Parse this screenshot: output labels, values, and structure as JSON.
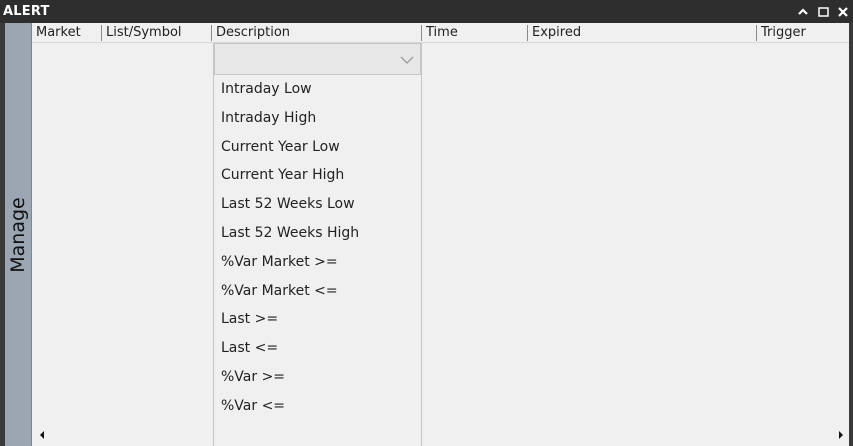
{
  "window": {
    "title": "ALERT"
  },
  "title_controls": [
    {
      "name": "minimize",
      "icon": "chevron-up-icon"
    },
    {
      "name": "maximize",
      "icon": "square-icon"
    },
    {
      "name": "close",
      "icon": "close-icon"
    }
  ],
  "side_tab": {
    "label": "Manage"
  },
  "columns": [
    {
      "label": "Market"
    },
    {
      "label": "List/Symbol"
    },
    {
      "label": "Description"
    },
    {
      "label": "Time"
    },
    {
      "label": "Expired"
    },
    {
      "label": "Trigger"
    }
  ],
  "description_filter": {
    "value": "",
    "icon": "chevron-down-icon"
  },
  "dropdown_options": [
    "Intraday Low",
    "Intraday High",
    "Current Year Low",
    "Current Year High",
    "Last 52 Weeks Low",
    "Last 52 Weeks High",
    "%Var Market >=",
    "%Var Market <=",
    "Last >=",
    "Last <=",
    "%Var >=",
    "%Var <="
  ],
  "scrollbar": {
    "left_icon": "triangle-left-icon",
    "right_icon": "triangle-right-icon"
  },
  "colors": {
    "titlebar": "#2e2e2e",
    "side_tab": "#9ba6b2",
    "background": "#f0f0f0"
  }
}
